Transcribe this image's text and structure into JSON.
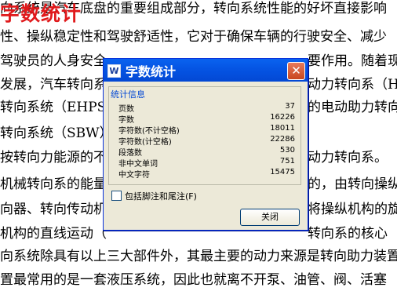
{
  "document": {
    "overlay_title": "字数统计",
    "lines": [
      "向系统是汽车底盘的重要组成部分，转向系统性能的好坏直接影响",
      "性、操纵稳定性和驾驶舒适性，它对于确保车辆的行驶安全、减少",
      "驾驶员的人身安全",
      "发展，汽车转向系",
      "转向系统（EHPS）",
      "转向系统（SBW）",
      "按转向力能源的不",
      "机械转向系的能量",
      "向器、转向传动机",
      "机构的直线运动（",
      "向系统除具有以上三大部件外，其最主要的动力来源是转向助力装置",
      "置最常用的是一套液压系统，因此也就离不开泵、油管、阀、活塞"
    ],
    "right_fragments": [
      "",
      "",
      "要作用。随着现",
      "动力转向系（HP",
      "的电动助力转向",
      "",
      "动力转向系。",
      "的，由转向操纵",
      "将操纵机构的旋",
      "转向系的核心",
      "",
      ""
    ]
  },
  "dialog": {
    "app_icon": "W",
    "title": "字数统计",
    "close_glyph": "✕",
    "group_label": "统计信息",
    "stats": [
      {
        "label": "页数",
        "value": "37"
      },
      {
        "label": "字数",
        "value": "16226"
      },
      {
        "label": "字符数(不计空格)",
        "value": "18011"
      },
      {
        "label": "字符数(计空格)",
        "value": "22286"
      },
      {
        "label": "段落数",
        "value": "530"
      },
      {
        "label": "非中文单词",
        "value": "751"
      },
      {
        "label": "中文字符",
        "value": "15475"
      }
    ],
    "checkbox_label": "包括脚注和尾注(F)",
    "close_button": "关闭"
  }
}
